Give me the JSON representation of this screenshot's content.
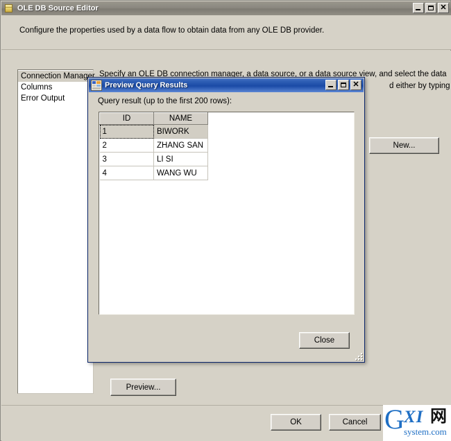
{
  "outer_window": {
    "title": "OLE DB Source Editor",
    "icon": "folder-icon",
    "description": "Configure the properties used by a data flow to obtain data from any OLE DB provider.",
    "window_controls": {
      "minimize": "_",
      "maximize": "□",
      "close": "✕"
    },
    "nav": {
      "items": [
        {
          "label": "Connection Manager",
          "selected": true
        },
        {
          "label": "Columns",
          "selected": false
        },
        {
          "label": "Error Output",
          "selected": false
        }
      ]
    },
    "panel": {
      "instruction_line_1": "Specify an OLE DB connection manager, a data source, or a data source view, and select the data",
      "instruction_line_2": "d either by typing"
    },
    "buttons": {
      "new": "New...",
      "preview": "Preview...",
      "ok": "OK",
      "cancel": "Cancel"
    }
  },
  "preview_dialog": {
    "title": "Preview Query Results",
    "icon": "grid-table-icon",
    "label": "Query result (up to the first 200 rows):",
    "window_controls": {
      "minimize": "_",
      "maximize": "□",
      "close": "✕"
    },
    "grid": {
      "columns": [
        "ID",
        "NAME"
      ],
      "rows": [
        {
          "ID": "1",
          "NAME": "BIWORK",
          "selected": true
        },
        {
          "ID": "2",
          "NAME": "ZHANG SAN",
          "selected": false
        },
        {
          "ID": "3",
          "NAME": "LI SI",
          "selected": false
        },
        {
          "ID": "4",
          "NAME": "WANG WU",
          "selected": false
        }
      ]
    },
    "buttons": {
      "close": "Close"
    }
  },
  "watermark": {
    "letter_g": "G",
    "letters_xi": "XI",
    "cjk": "网",
    "domain": "system.com"
  },
  "colors": {
    "outer_title_bar": "#8b8880",
    "dialog_title_bar": "#1a4aa6",
    "window_face": "#d6d2c7",
    "button_face": "#d4d0c8",
    "selection": "#d2cec4",
    "watermark_blue": "#1f6fc4"
  }
}
